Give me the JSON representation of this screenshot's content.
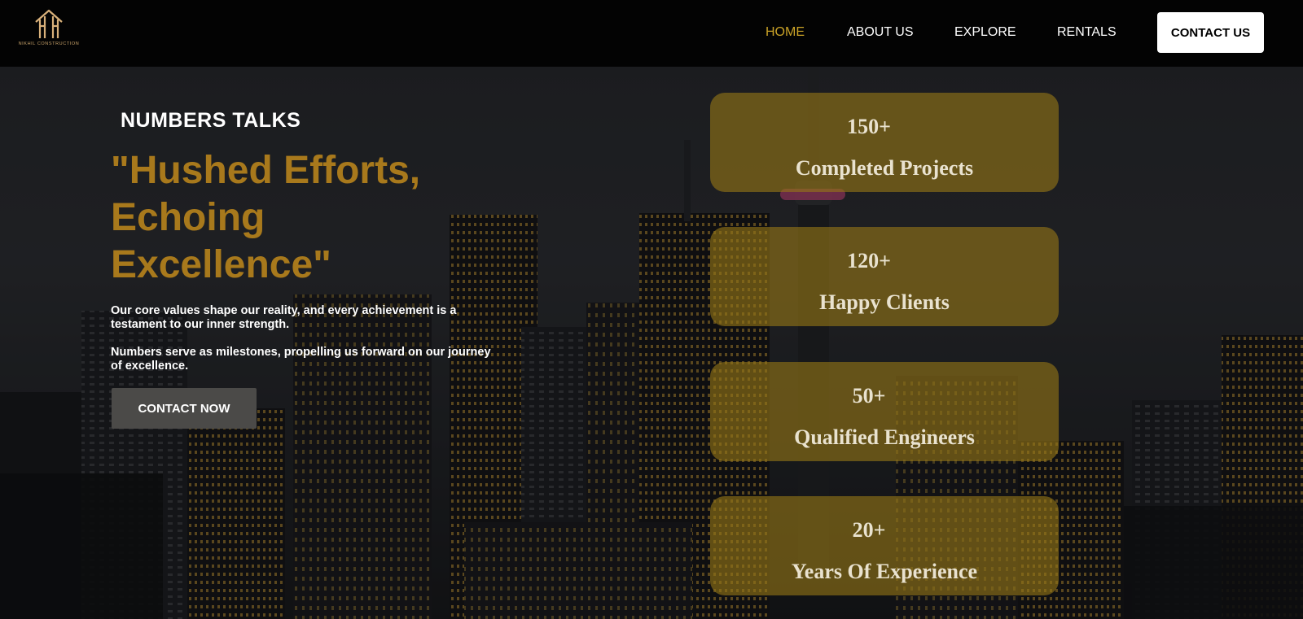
{
  "brand": {
    "name": "NIKHIL CONSTRUCTION",
    "logo_icon": "house-monogram-icon",
    "accent": "#c9a227"
  },
  "nav": {
    "items": [
      {
        "label": "HOME",
        "active": true
      },
      {
        "label": "ABOUT US",
        "active": false
      },
      {
        "label": "EXPLORE",
        "active": false
      },
      {
        "label": "RENTALS",
        "active": false
      }
    ],
    "contact_label": "CONTACT US"
  },
  "hero": {
    "kicker": "NUMBERS TALKS",
    "headline": "\"Hushed Efforts, Echoing Excellence\"",
    "paragraphs": [
      "Our core values shape our reality, and every achievement is a testament to our inner strength.",
      "Numbers serve as milestones, propelling us forward on our journey of excellence."
    ],
    "cta_label": "CONTACT NOW",
    "headline_color": "#a8791c"
  },
  "stats": [
    {
      "value": "150+",
      "label": "Completed Projects"
    },
    {
      "value": "120+",
      "label": "Happy Clients"
    },
    {
      "value": "50+",
      "label": "Qualified Engineers"
    },
    {
      "value": "20+",
      "label": "Years Of Experience"
    }
  ],
  "colors": {
    "card": "#94761699",
    "header_bg": "#030303",
    "cta_bg": "#4b4a48"
  }
}
